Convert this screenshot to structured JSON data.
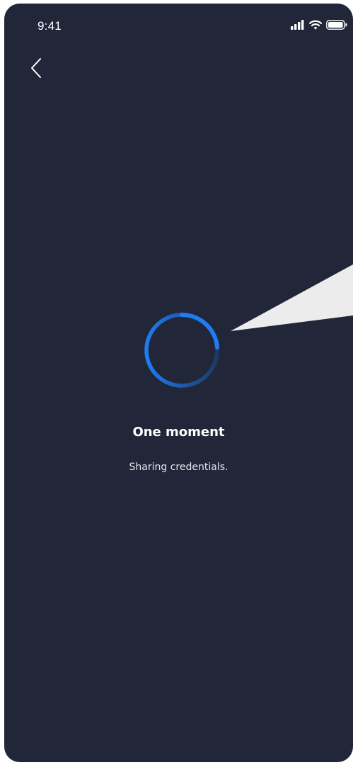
{
  "status_bar": {
    "time": "9:41",
    "icons": [
      "signal-icon",
      "wifi-icon",
      "battery-icon"
    ]
  },
  "navigation": {
    "back_icon": "chevron-left-icon"
  },
  "loading": {
    "title": "One moment",
    "message": "Sharing credentials.",
    "spinner_icon": "loading-spinner-icon"
  },
  "colors": {
    "background": "#212739",
    "accent": "#1f7cf2",
    "callout": "#ececec",
    "text": "#ffffff"
  }
}
